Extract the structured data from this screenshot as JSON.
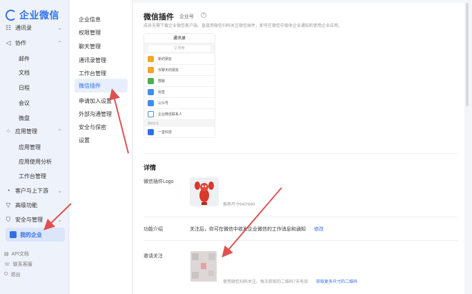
{
  "app": {
    "title": "企业微信"
  },
  "sidebar": {
    "items": [
      {
        "label": "通讯录",
        "icon": "contacts-icon",
        "chevron": "⌄"
      },
      {
        "label": "协作",
        "icon": "collab-icon",
        "chevron": "⌃"
      },
      {
        "label": "应用管理",
        "icon": "apps-icon",
        "chevron": "⌃"
      },
      {
        "label": "客户与上下游",
        "icon": "customers-icon",
        "chevron": "⌄"
      },
      {
        "label": "高级功能",
        "icon": "advanced-icon",
        "chevron": ""
      },
      {
        "label": "安全与管理",
        "icon": "shield-icon",
        "chevron": "⌄"
      }
    ],
    "collab_sub": [
      "邮件",
      "文档",
      "日程",
      "会议",
      "微盘"
    ],
    "apps_sub": [
      "应用管理",
      "应用使用分析",
      "工作台管理"
    ],
    "active": "我的企业",
    "footer": [
      "API文档",
      "联系客服",
      "退出"
    ]
  },
  "nav": {
    "items": [
      "企业信息",
      "权限管理",
      "聊天管理",
      "通讯录管理",
      "工作台管理",
      "微信插件",
      "申请加入设置",
      "外部沟通管理",
      "安全与保密",
      "设置"
    ],
    "active_label": "微信插件"
  },
  "main": {
    "title": "微信插件",
    "tag": "企业号",
    "help": "?",
    "description": "成员无需下载企业微信客户端，直接用微信扫码关注微信插件，即可在微信中接收企业通知和使用企业应用。",
    "preview": {
      "header": "通讯录",
      "search": "Q 搜索",
      "rows": [
        "新的朋友",
        "仅聊天的朋友",
        "群聊",
        "标签",
        "公众号",
        "企业微信联系人"
      ],
      "section": "我的企业",
      "company": "一堂科技"
    },
    "details_title": "详情",
    "logo_label": "微信插件Logo",
    "logo_hint": "推荐尺寸640*640",
    "intro_label": "功能介绍",
    "intro_text": "关注后，你可在微信中收发企业微信的工作消息和通知",
    "intro_edit": "修改",
    "invite_label": "邀请关注",
    "qr_hint": "使用微信扫码关注，每次获取的二维码7天有效",
    "qr_link": "获取更多尺寸的二维码"
  },
  "colors": {
    "accent": "#2f6fec",
    "arrow": "#e05050"
  }
}
